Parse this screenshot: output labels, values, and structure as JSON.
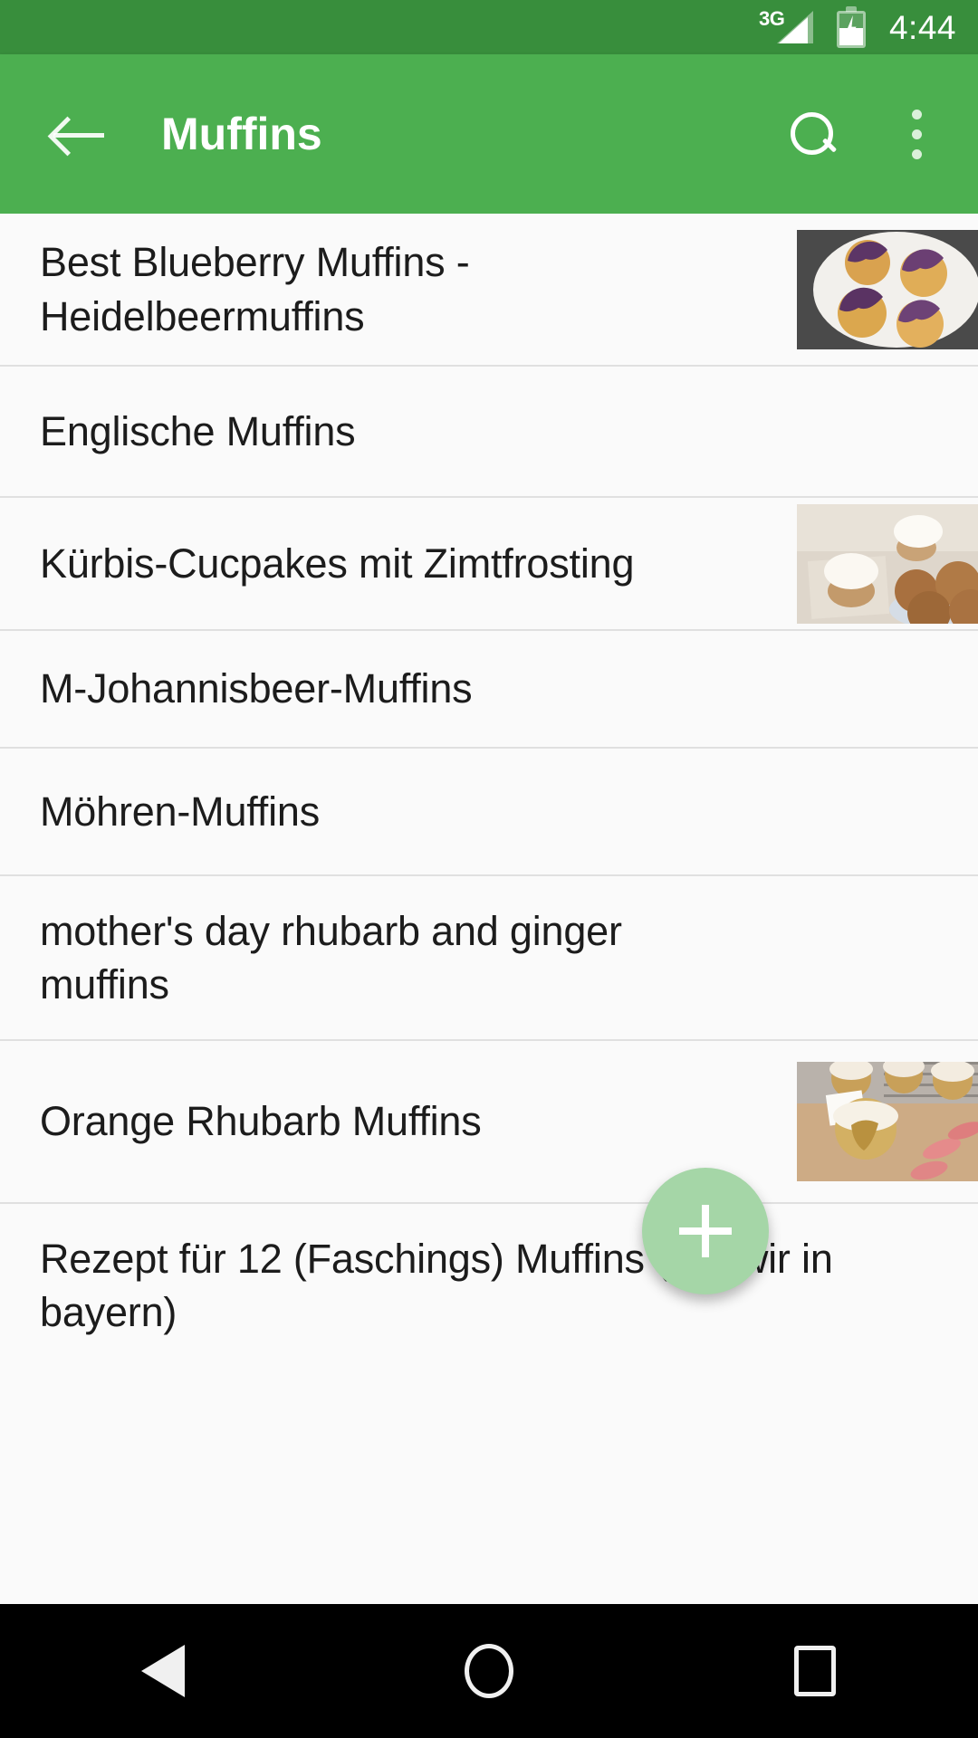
{
  "status_bar": {
    "network_label": "3G",
    "network_icon": "signal-3g-icon",
    "battery_icon": "battery-charging-icon",
    "time": "4:44"
  },
  "app_bar": {
    "back_icon": "back-arrow-icon",
    "title": "Muffins",
    "search_icon": "search-icon",
    "overflow_icon": "overflow-menu-icon"
  },
  "list": {
    "items": [
      {
        "title": "Best Blueberry Muffins - Heidelbeermuffins",
        "has_thumbnail": true,
        "thumbnail_alt": "blueberry-muffins-on-white-plate"
      },
      {
        "title": "Englische Muffins",
        "has_thumbnail": false,
        "thumbnail_alt": ""
      },
      {
        "title": "Kürbis-Cucpakes mit Zimtfrosting",
        "has_thumbnail": true,
        "thumbnail_alt": "frosted-cupcakes-and-muffins"
      },
      {
        "title": "M-Johannisbeer-Muffins",
        "has_thumbnail": false,
        "thumbnail_alt": ""
      },
      {
        "title": "Möhren-Muffins",
        "has_thumbnail": false,
        "thumbnail_alt": ""
      },
      {
        "title": "mother's day rhubarb and ginger muffins",
        "has_thumbnail": false,
        "thumbnail_alt": ""
      },
      {
        "title": "Orange Rhubarb Muffins",
        "has_thumbnail": true,
        "thumbnail_alt": "glazed-muffins-with-rhubarb-slices"
      },
      {
        "title": "Rezept für 12  (Faschings) Muffins (BR-wir in bayern)",
        "has_thumbnail": false,
        "thumbnail_alt": ""
      }
    ]
  },
  "fab": {
    "icon": "plus-icon",
    "label": "+"
  },
  "nav_bar": {
    "back_icon": "nav-back-icon",
    "home_icon": "nav-home-icon",
    "recents_icon": "nav-recents-icon"
  },
  "colors": {
    "status_bar_green": "#388e3c",
    "app_bar_green": "#4caf50",
    "fab_green": "#a5d6a7",
    "list_background": "#fafafa",
    "divider": "#e0e0e0",
    "text_primary": "#1c1c1c"
  }
}
